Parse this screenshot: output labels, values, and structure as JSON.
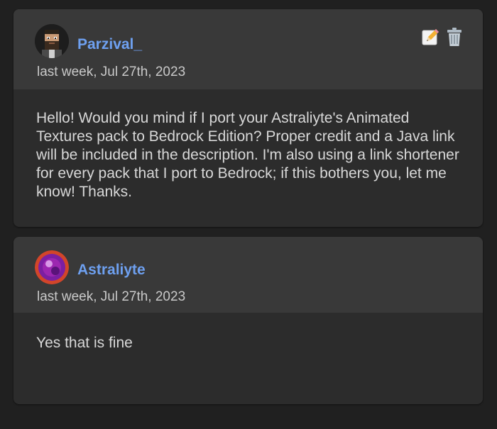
{
  "comments": [
    {
      "username": "Parzival_",
      "timestamp": "last week, Jul 27th, 2023",
      "body": "Hello! Would you mind if I port your Astraliyte's Animated Textures pack to Bedrock Edition? Proper credit and a Java link will be included in the description. I'm also using a link shortener for every pack that I port to Bedrock; if this bothers you, let me know! Thanks.",
      "avatar_icon": "pixel-bearded-man-avatar",
      "actions": [
        "edit-icon",
        "delete-icon"
      ]
    },
    {
      "username": "Astraliyte",
      "timestamp": "last week, Jul 27th, 2023",
      "body": "Yes that is fine",
      "avatar_icon": "purple-orb-avatar"
    }
  ],
  "colors": {
    "background": "#202020",
    "card": "#2c2c2c",
    "card_header": "#393939",
    "username": "#6ea0f0",
    "text": "#d8d8d8",
    "timestamp": "#c9c9c9"
  }
}
